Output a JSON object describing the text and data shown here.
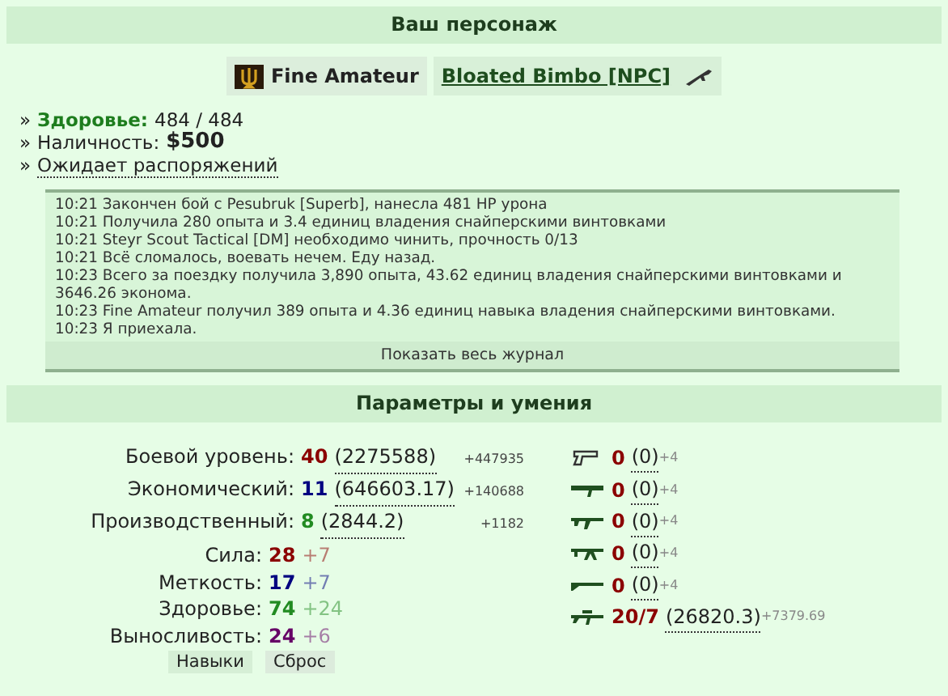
{
  "character_section": {
    "title": "Ваш персонаж",
    "player": {
      "name": "Fine Amateur"
    },
    "opponent": {
      "name": "Bloated Bimbo [NPC]"
    },
    "health": {
      "bullet": "»",
      "label": "Здоровье:",
      "value": "484 / 484"
    },
    "cash": {
      "bullet": "»",
      "label": "Наличность:",
      "value": "$500"
    },
    "status": {
      "bullet": "»",
      "text": "Ожидает распоряжений"
    },
    "log": [
      "10:21 Закончен бой с Pesubruk [Superb], нанесла 481 HP урона",
      "10:21 Получила 280 опыта и 3.4 единиц владения снайперскими винтовками",
      "10:21 Steyr Scout Tactical [DM] необходимо чинить, прочность 0/13",
      "10:21 Всё сломалось, воевать нечем. Еду назад.",
      "10:23 Всего за поездку получила 3,890 опыта, 43.62 единиц владения снайперскими винтовками и 3646.26 эконома.",
      "10:23 Fine Amateur получил 389 опыта и 4.36 единиц навыка владения снайперскими винтовками.",
      "10:23 Я приехала."
    ],
    "log_button": "Показать весь журнал"
  },
  "skills_section": {
    "title": "Параметры и умения",
    "levels": [
      {
        "label": "Боевой уровень:",
        "value": "40",
        "points": "(2275588)",
        "gain": "+447935",
        "color": "#8b0000"
      },
      {
        "label": "Экономический:",
        "value": "11",
        "points": "(646603.17)",
        "gain": "+140688",
        "color": "#000080"
      },
      {
        "label": "Производственный:",
        "value": "8",
        "points": "(2844.2)",
        "gain": "+1182",
        "color": "#228b22"
      }
    ],
    "attributes": [
      {
        "label": "Сила:",
        "value": "28",
        "bonus": "+7",
        "color": "#8b0000"
      },
      {
        "label": "Меткость:",
        "value": "17",
        "bonus": "+7",
        "color": "#000080"
      },
      {
        "label": "Здоровье:",
        "value": "74",
        "bonus": "+24",
        "color": "#228b22"
      },
      {
        "label": "Выносливость:",
        "value": "24",
        "bonus": "+6",
        "color": "#660066"
      }
    ],
    "buttons": [
      "Навыки",
      "Сброс"
    ],
    "weapons": [
      {
        "kind": "pistol",
        "value": "0",
        "points": "(0)",
        "gain": "+4"
      },
      {
        "kind": "launcher",
        "value": "0",
        "points": "(0)",
        "gain": "+4"
      },
      {
        "kind": "rifle",
        "value": "0",
        "points": "(0)",
        "gain": "+4"
      },
      {
        "kind": "machinegun",
        "value": "0",
        "points": "(0)",
        "gain": "+4"
      },
      {
        "kind": "shotgun",
        "value": "0",
        "points": "(0)",
        "gain": "+4"
      },
      {
        "kind": "sniper",
        "value": "20/7",
        "points": "(26820.3)",
        "gain": "+7379.69"
      }
    ]
  }
}
